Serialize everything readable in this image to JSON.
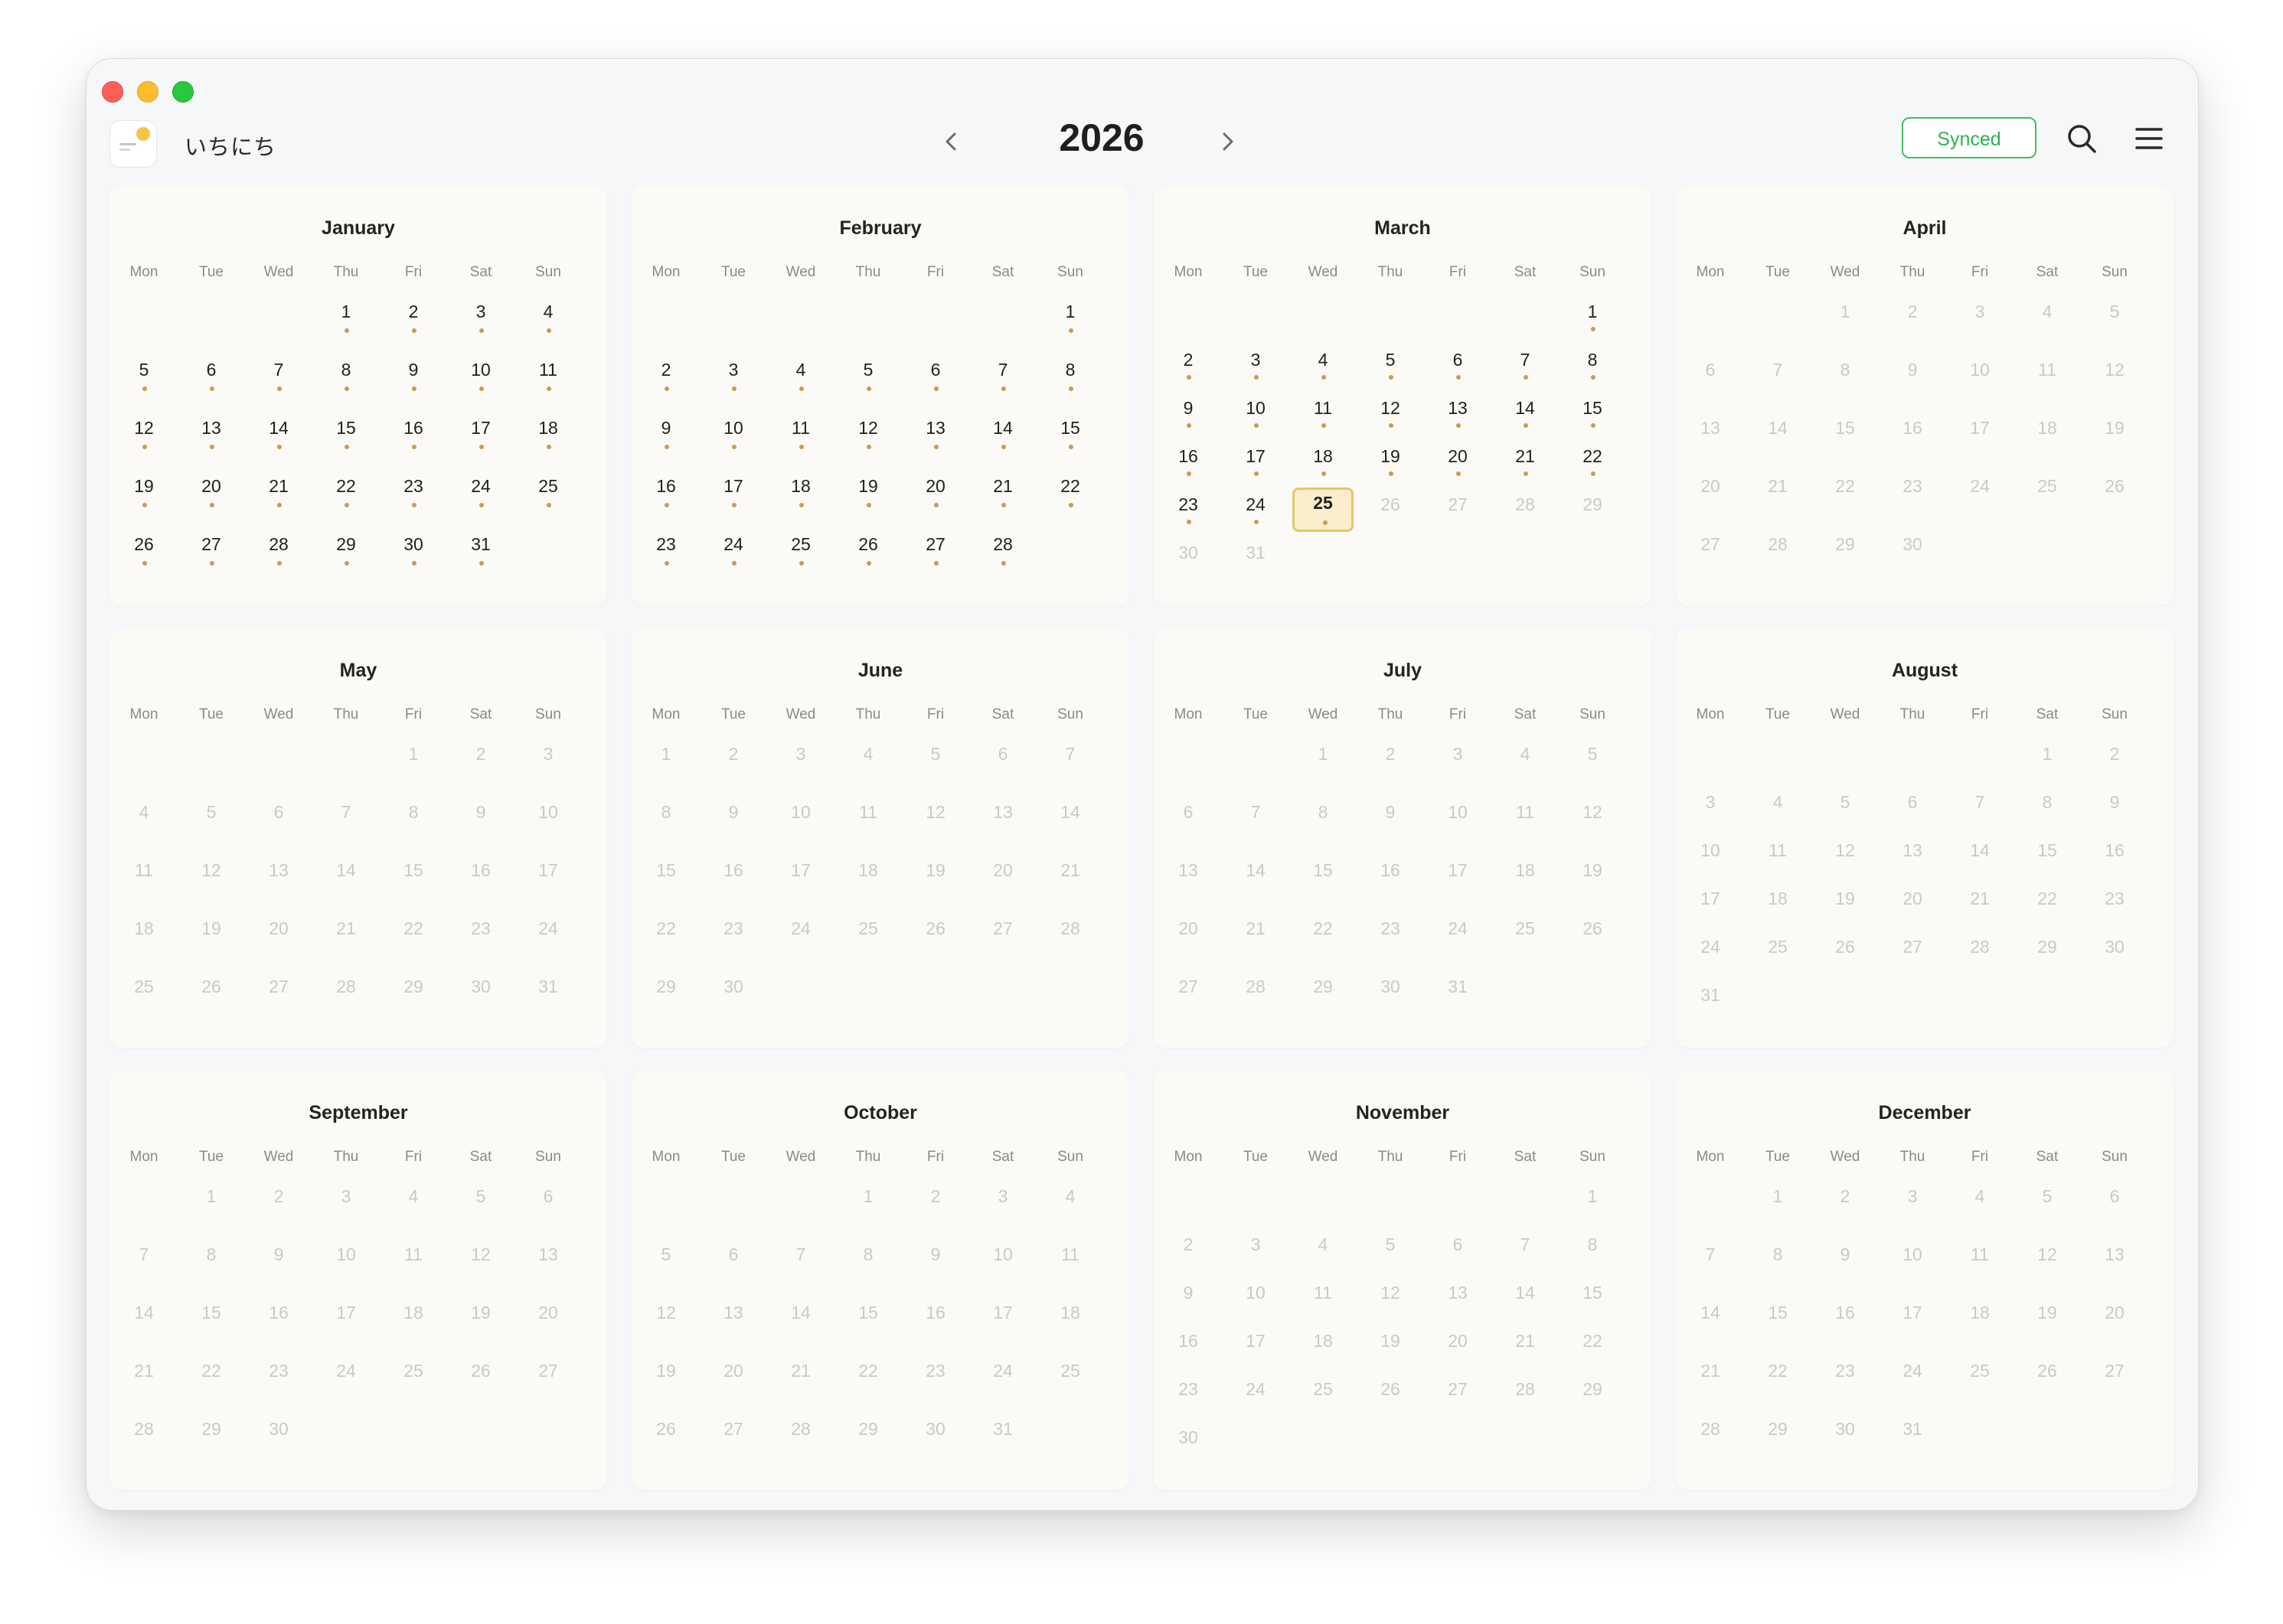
{
  "app": {
    "name": "いちにち"
  },
  "header": {
    "year": "2026",
    "sync_status": "Synced"
  },
  "colors": {
    "accent_dot": "#cf9a4e",
    "today_fill": "#fbeeca",
    "today_border": "#e6c56e",
    "synced_green": "#2fb14f"
  },
  "icons": {
    "prev": "chevron-left-icon",
    "next": "chevron-right-icon",
    "search": "search-icon",
    "menu": "hamburger-menu-icon"
  },
  "weekdays": [
    "Mon",
    "Tue",
    "Wed",
    "Thu",
    "Fri",
    "Sat",
    "Sun"
  ],
  "today": {
    "month": 3,
    "day": 25
  },
  "months": [
    {
      "name": "January",
      "offset": 3,
      "days": 31,
      "active_through": 31
    },
    {
      "name": "February",
      "offset": 6,
      "days": 28,
      "active_through": 28
    },
    {
      "name": "March",
      "offset": 6,
      "days": 31,
      "active_through": 25
    },
    {
      "name": "April",
      "offset": 2,
      "days": 30,
      "active_through": 0
    },
    {
      "name": "May",
      "offset": 4,
      "days": 31,
      "active_through": 0
    },
    {
      "name": "June",
      "offset": 0,
      "days": 30,
      "active_through": 0
    },
    {
      "name": "July",
      "offset": 2,
      "days": 31,
      "active_through": 0
    },
    {
      "name": "August",
      "offset": 5,
      "days": 31,
      "active_through": 0
    },
    {
      "name": "September",
      "offset": 1,
      "days": 30,
      "active_through": 0
    },
    {
      "name": "October",
      "offset": 3,
      "days": 31,
      "active_through": 0
    },
    {
      "name": "November",
      "offset": 6,
      "days": 30,
      "active_through": 0
    },
    {
      "name": "December",
      "offset": 1,
      "days": 31,
      "active_through": 0
    }
  ]
}
